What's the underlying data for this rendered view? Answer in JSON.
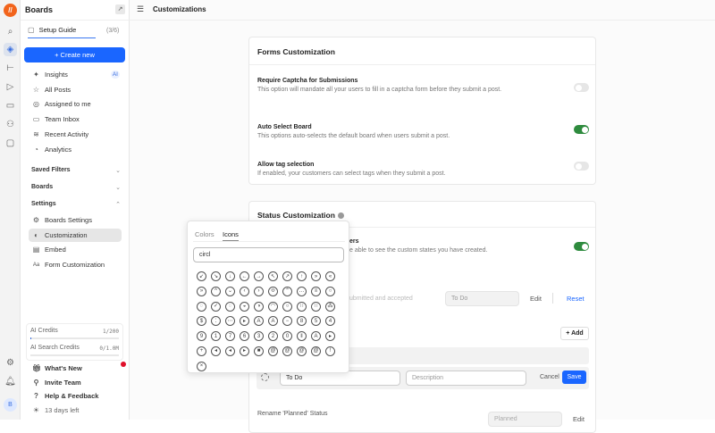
{
  "header": {
    "title": "Customizations"
  },
  "sidebar": {
    "title": "Boards",
    "setup_guide": "Setup Guide",
    "setup_progress": "(3/6)",
    "create_new": "+ Create new",
    "items": [
      {
        "label": "Insights",
        "icon": "sparkle-icon",
        "badge": "AI"
      },
      {
        "label": "All Posts",
        "icon": "star-icon"
      },
      {
        "label": "Assigned to me",
        "icon": "at-icon"
      },
      {
        "label": "Team Inbox",
        "icon": "inbox-icon"
      },
      {
        "label": "Recent Activity",
        "icon": "rss-icon"
      },
      {
        "label": "Analytics",
        "icon": "gauge-icon"
      }
    ],
    "sections": {
      "saved_filters": "Saved Filters",
      "boards": "Boards",
      "settings": "Settings"
    },
    "settings_items": [
      {
        "label": "Boards Settings"
      },
      {
        "label": "Customization"
      },
      {
        "label": "Embed"
      },
      {
        "label": "Form Customization"
      }
    ],
    "credits": [
      {
        "label": "AI Credits",
        "value": "1/200",
        "fraction": 0.005
      },
      {
        "label": "AI Search Credits",
        "value": "0/1.0M",
        "fraction": 0
      }
    ],
    "footer": [
      {
        "label": "What's New"
      },
      {
        "label": "Invite Team"
      },
      {
        "label": "Help & Feedback"
      },
      {
        "label": "13 days left"
      }
    ],
    "avatar": "B"
  },
  "forms": {
    "title": "Forms Customization",
    "rows": [
      {
        "title": "Require Captcha for Submissions",
        "desc": "This option will mandate all your users to fill in a captcha form before they submit a post.",
        "on": false
      },
      {
        "title": "Auto Select Board",
        "desc": "This options auto-selects the default board when users submit a post.",
        "on": true
      },
      {
        "title": "Allow tag selection",
        "desc": "If enabled, your customers can select tags when they submit a post.",
        "on": false
      }
    ]
  },
  "status": {
    "title": "Status Customization",
    "row1_title": "ers",
    "row1_desc": "e able to see the custom states you have created.",
    "row2_desc": "ubmitted and accepted",
    "row2_value": "To Do",
    "edit": "Edit",
    "reset": "Reset",
    "add": "+ Add",
    "edit_name": "To Do",
    "edit_desc_placeholder": "Description",
    "cancel": "Cancel",
    "save": "Save",
    "rename_planned": "Rename 'Planned' Status",
    "planned_value": "Planned"
  },
  "picker": {
    "tabs": [
      "Colors",
      "Icons"
    ],
    "active_tab": "Icons",
    "search": "circl",
    "icon_count": 61
  },
  "colors": {
    "accent": "#1a66ff",
    "toggle_on": "#2e8b3e"
  }
}
